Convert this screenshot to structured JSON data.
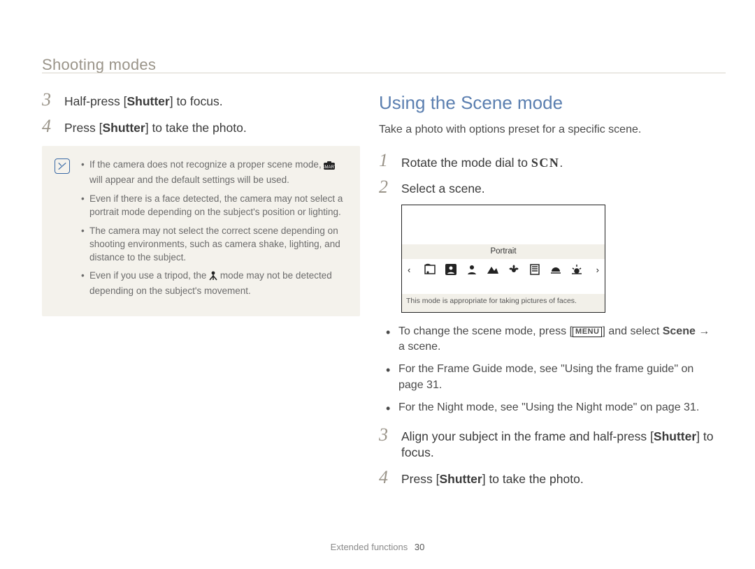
{
  "header": {
    "title": "Shooting modes"
  },
  "left": {
    "steps": [
      {
        "num": "3",
        "text_before": "Half-press [",
        "bold": "Shutter",
        "text_after": "] to focus."
      },
      {
        "num": "4",
        "text_before": "Press [",
        "bold": "Shutter",
        "text_after": "] to take the photo."
      }
    ],
    "note": {
      "bullets": [
        {
          "before": "If the camera does not recognize a proper scene mode, ",
          "icon": "smart-icon",
          "after": " will appear and the default settings will be used."
        },
        {
          "before": "Even if there is a face detected, the camera may not select a portrait mode depending on the subject's position or lighting."
        },
        {
          "before": "The camera may not select the correct scene depending on shooting environments, such as camera shake, lighting, and distance to the subject."
        },
        {
          "before": "Even if you use a tripod, the ",
          "icon": "tripod-icon",
          "after": " mode may not be detected depending on the subject's movement."
        }
      ]
    }
  },
  "right": {
    "section_title": "Using the Scene mode",
    "section_intro": "Take a photo with options preset for a specific scene.",
    "step1": {
      "num": "1",
      "before": "Rotate the mode dial to ",
      "scn": "SCN",
      "after": "."
    },
    "step2": {
      "num": "2",
      "text": "Select a scene."
    },
    "lcd": {
      "selected_label": "Portrait",
      "hint": "This mode is appropriate for taking pictures of faces.",
      "icon_names": [
        "frame-guide-icon",
        "portrait-icon",
        "children-icon",
        "landscape-icon",
        "closeup-icon",
        "text-icon",
        "sunset-icon",
        "dawn-icon"
      ]
    },
    "sub_bullets": [
      {
        "before": "To change the scene mode, press [",
        "menu": "MENU",
        "mid": "] and select ",
        "bold": "Scene",
        "after": " → a scene."
      },
      {
        "text": "For the Frame Guide mode, see \"Using the frame guide\" on page 31."
      },
      {
        "text": "For the Night mode, see \"Using the Night mode\" on page 31."
      }
    ],
    "step3": {
      "num": "3",
      "before": "Align your subject in the frame and half-press [",
      "bold": "Shutter",
      "after": "] to focus."
    },
    "step4": {
      "num": "4",
      "before": "Press [",
      "bold": "Shutter",
      "after": "] to take the photo."
    }
  },
  "footer": {
    "label": "Extended functions",
    "page": "30"
  }
}
